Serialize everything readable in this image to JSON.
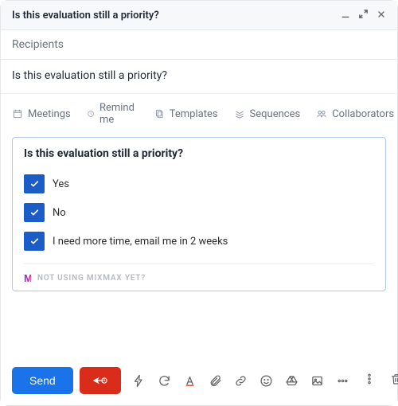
{
  "header": {
    "title": "Is this evaluation still a priority?",
    "icons": {
      "minimize": "minimize-icon",
      "expand": "expand-icon",
      "close": "close-icon"
    }
  },
  "recipients": {
    "placeholder": "Recipients"
  },
  "subject": {
    "value": "Is this evaluation still a priority?"
  },
  "mm_toolbar": {
    "items": [
      {
        "label": "Meetings"
      },
      {
        "label": "Remind me"
      },
      {
        "label": "Templates"
      },
      {
        "label": "Sequences"
      },
      {
        "label": "Collaborators"
      }
    ]
  },
  "poll": {
    "question": "Is this evaluation still a priority?",
    "options": [
      {
        "label": "Yes"
      },
      {
        "label": "No"
      },
      {
        "label": "I need more time, email me in 2 weeks"
      }
    ],
    "footer_text": "NOT USING MIXMAX YET?",
    "logo_text": "M"
  },
  "actions": {
    "send_label": "Send"
  },
  "colors": {
    "accent_blue": "#1a73e8",
    "accent_red": "#d92c1b",
    "poll_blue": "#1b5cc6"
  }
}
